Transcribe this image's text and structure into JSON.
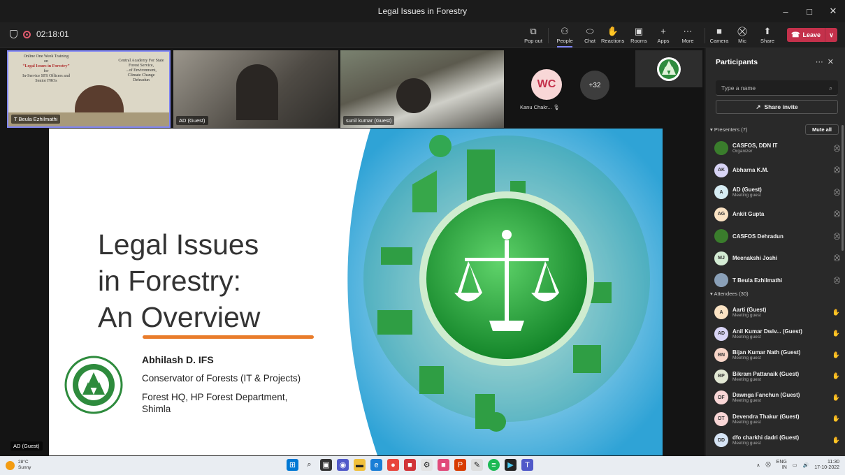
{
  "window": {
    "title": "Legal Issues in Forestry",
    "min": "–",
    "max": "□",
    "close": "✕"
  },
  "meeting": {
    "timer": "02:18:01"
  },
  "toolbar": {
    "popout": "Pop out",
    "people": "People",
    "chat": "Chat",
    "reactions": "Reactions",
    "rooms": "Rooms",
    "apps": "Apps",
    "more": "More",
    "camera": "Camera",
    "mic": "Mic",
    "share": "Share",
    "leave": "Leave"
  },
  "tiles": {
    "t1": "T Beula Ezhilmathi",
    "t2": "AD (Guest)",
    "t3": "sunil kumar (Guest)",
    "wc_initials": "WC",
    "kanu": "Kanu Chakr...",
    "overflow": "+32",
    "t1_slide_text": [
      "Online One Week Training",
      "on",
      "“Legal Issues in Forestry”",
      "for",
      "In-Service SFS Officers and",
      "Senior FROs",
      "Central Academy For State",
      "Forest Service,",
      "...of Environment,",
      "Climate Change",
      "Dehradun"
    ]
  },
  "slide": {
    "title": [
      "Legal Issues",
      "in Forestry:",
      "An Overview"
    ],
    "presenter": "Abhilash D. IFS",
    "role": "Conservator of Forests (IT & Projects)",
    "org": "Forest HQ, HP Forest Department, Shimla"
  },
  "stage": {
    "speaker_label": "AD (Guest)"
  },
  "panel": {
    "title": "Participants",
    "search_placeholder": "Type a name",
    "invite": "Share invite",
    "presenters_header": "Presenters (7)",
    "mute_all": "Mute all",
    "attendees_header": "Attendees (30)",
    "presenters": [
      {
        "name": "CASFOS, DDN IT",
        "role": "Organizer",
        "initials": "",
        "color": "#3a7d2c"
      },
      {
        "name": "Abharna K.M.",
        "role": "",
        "initials": "AK",
        "color": "#d8d4f5"
      },
      {
        "name": "AD (Guest)",
        "role": "Meeting guest",
        "initials": "A",
        "color": "#d6ecf3"
      },
      {
        "name": "Ankit Gupta",
        "role": "",
        "initials": "AG",
        "color": "#fbe3c4"
      },
      {
        "name": "CASFOS Dehradun",
        "role": "",
        "initials": "",
        "color": "#3a7d2c"
      },
      {
        "name": "Meenakshi Joshi",
        "role": "",
        "initials": "MJ",
        "color": "#d4ecd4"
      },
      {
        "name": "T Beula Ezhilmathi",
        "role": "",
        "initials": "",
        "color": "#8aa0b8"
      }
    ],
    "attendees": [
      {
        "name": "Aarti (Guest)",
        "role": "Meeting guest",
        "initials": "A",
        "color": "#fbe3c4"
      },
      {
        "name": "Anil Kumar Dwiv... (Guest)",
        "role": "Meeting guest",
        "initials": "AD",
        "color": "#d8d4f5"
      },
      {
        "name": "Bijan Kumar Nath (Guest)",
        "role": "Meeting guest",
        "initials": "BN",
        "color": "#f7d5c8"
      },
      {
        "name": "Bikram Pattanaik (Guest)",
        "role": "Meeting guest",
        "initials": "BP",
        "color": "#e2e8d4"
      },
      {
        "name": "Dawnga Fanchun (Guest)",
        "role": "Meeting guest",
        "initials": "DF",
        "color": "#f9d6d6"
      },
      {
        "name": "Devendra Thakur (Guest)",
        "role": "Meeting guest",
        "initials": "DT",
        "color": "#f9d6d6"
      },
      {
        "name": "dfo charkhi dadri (Guest)",
        "role": "Meeting guest",
        "initials": "DD",
        "color": "#d6e4f5"
      }
    ]
  },
  "taskbar": {
    "temp": "28°C",
    "weather": "Sunny",
    "lang1": "ENG",
    "lang2": "IN",
    "time": "11:30",
    "date": "17-10-2022"
  }
}
